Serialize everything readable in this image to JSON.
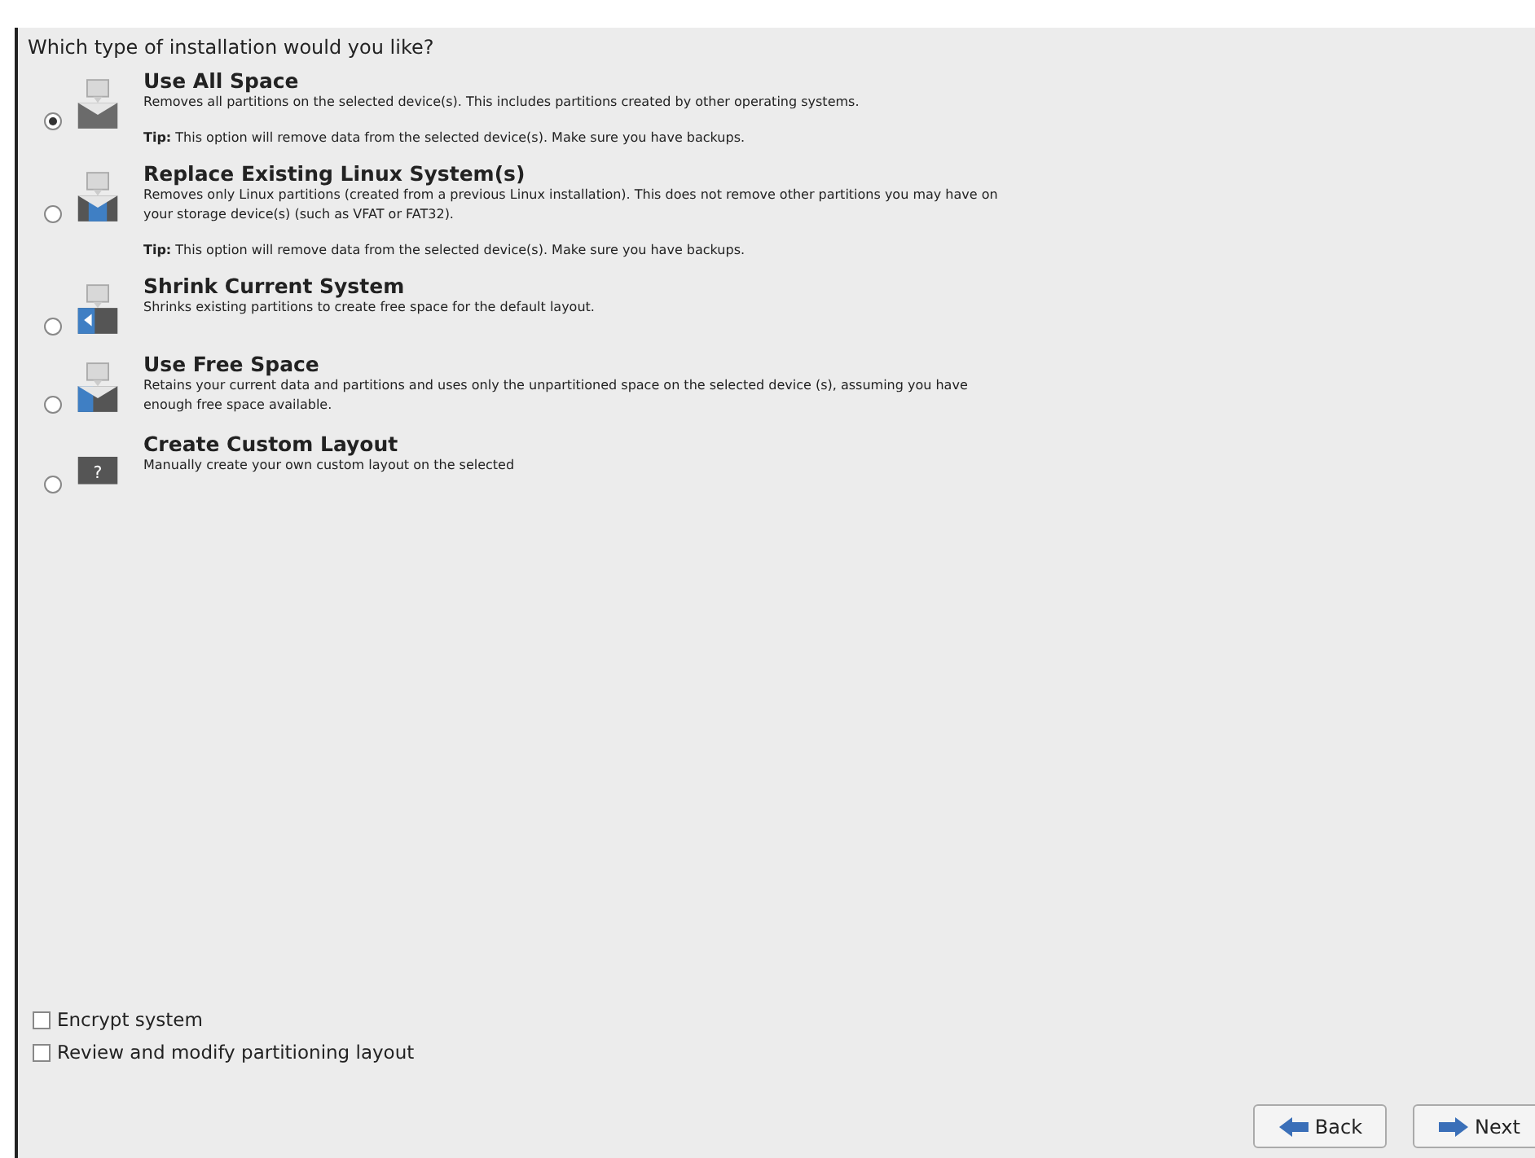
{
  "heading": "Which type of installation would you like?",
  "options": [
    {
      "kind": "all",
      "title": "Use All Space",
      "description": "Removes all partitions on the selected device(s).  This includes partitions created by other operating systems.",
      "tip": "**Tip:** This option will remove data from the selected device(s).  Make sure you have backups.",
      "selected": true
    },
    {
      "kind": "replace",
      "title": "Replace Existing Linux System(s)",
      "description": "Removes only Linux partitions (created from a previous Linux installation).  This does not remove other partitions you may have on your storage device(s) (such as VFAT or FAT32).",
      "tip": "**Tip:** This option will remove data from the selected device(s).  Make sure you have backups.",
      "selected": false
    },
    {
      "kind": "shrink",
      "title": "Shrink Current System",
      "description": "Shrinks existing partitions to create free space for the default layout.",
      "selected": false
    },
    {
      "kind": "free",
      "title": "Use Free Space",
      "description": "Retains your current data and partitions and uses only the unpartitioned space on the selected device (s), assuming you have enough free space available.",
      "selected": false
    },
    {
      "kind": "custom",
      "icon_text": "?",
      "title": "Create Custom Layout",
      "description": "Manually create your own custom layout on the selected",
      "selected": false
    }
  ],
  "checkboxes": [
    {
      "label": "Encrypt system",
      "checked": false
    },
    {
      "label": "Review and modify partitioning layout",
      "checked": false
    }
  ],
  "buttons": [
    {
      "kind": "back",
      "label": "Back"
    },
    {
      "kind": "next",
      "label": "Next"
    }
  ]
}
